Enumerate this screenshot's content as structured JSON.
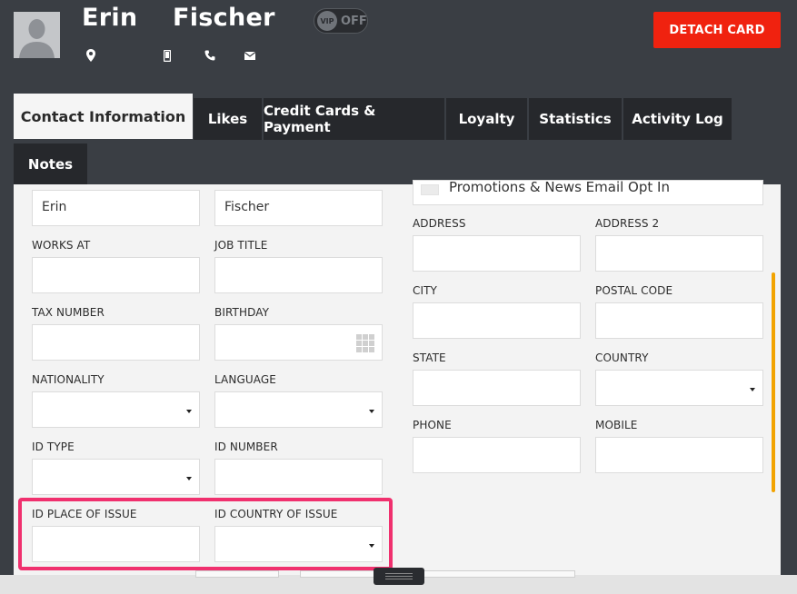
{
  "header": {
    "first_name": "Erin",
    "last_name": "Fischer",
    "vip_badge": "VIP",
    "vip_state": "OFF",
    "detach_label": "DETACH CARD"
  },
  "icons": {
    "avatar": "person-silhouette-icon",
    "location": "map-pin-icon",
    "mobile": "mobile-phone-icon",
    "phone": "phone-handset-icon",
    "email": "envelope-icon"
  },
  "tabs": [
    {
      "label": "Contact Information"
    },
    {
      "label": "Likes"
    },
    {
      "label": "Credit Cards & Payment"
    },
    {
      "label": "Loyalty"
    },
    {
      "label": "Statistics"
    },
    {
      "label": "Activity Log"
    },
    {
      "label": "Notes"
    }
  ],
  "form": {
    "first_name_value": "Erin",
    "last_name_value": "Fischer",
    "works_at": "WORKS AT",
    "job_title": "JOB TITLE",
    "tax_number": "TAX NUMBER",
    "birthday": "BIRTHDAY",
    "nationality": "NATIONALITY",
    "language": "LANGUAGE",
    "id_type": "ID TYPE",
    "id_number": "ID NUMBER",
    "id_place": "ID PLACE OF ISSUE",
    "id_country": "ID COUNTRY OF ISSUE",
    "optin": "Promotions & News Email Opt In",
    "address": "ADDRESS",
    "address2": "ADDRESS 2",
    "city": "CITY",
    "postal_code": "POSTAL CODE",
    "state": "STATE",
    "country": "COUNTRY",
    "phone": "PHONE",
    "mobile": "MOBILE"
  },
  "colors": {
    "background": "#3a3e44",
    "tab_dark": "#26282c",
    "detach_red": "#f0220f",
    "highlight_pink": "#f0306e",
    "scrollbar_orange": "#f2a300"
  }
}
